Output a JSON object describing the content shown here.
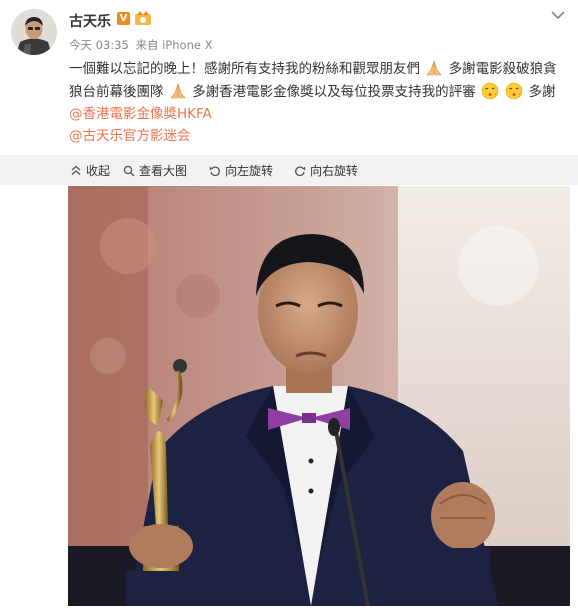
{
  "post": {
    "author": "古天乐",
    "verified_badge": "V",
    "time": "今天 03:35",
    "source": "来自 iPhone X",
    "line1_part1": "一個難以忘記的晚上！感謝所有支持我的粉絲和觀眾朋友們",
    "line1_part2": "多謝電影殺破狼貪",
    "line2_part1": "狼台前幕後團隊",
    "line2_part2": "多謝香港電影金像獎以及每位投票支持我的評審",
    "line2_part3": "多謝",
    "mention1": "@香港電影金像獎HKFA",
    "mention2": "@古天乐官方影迷会"
  },
  "toolbar": {
    "collapse": "收起",
    "view_large": "查看大图",
    "rotate_left": "向左旋转",
    "rotate_right": "向右旋转"
  },
  "icons": {
    "avatar": "user-avatar",
    "badge": "fan-badge-icon",
    "more": "chevron-down-icon",
    "pray": "folded-hands-emoji",
    "kiss": "kiss-face-emoji"
  },
  "colors": {
    "mention": "#eb7350",
    "toolbar_bg": "#f2f2f5",
    "verified": "#f08a1c"
  }
}
